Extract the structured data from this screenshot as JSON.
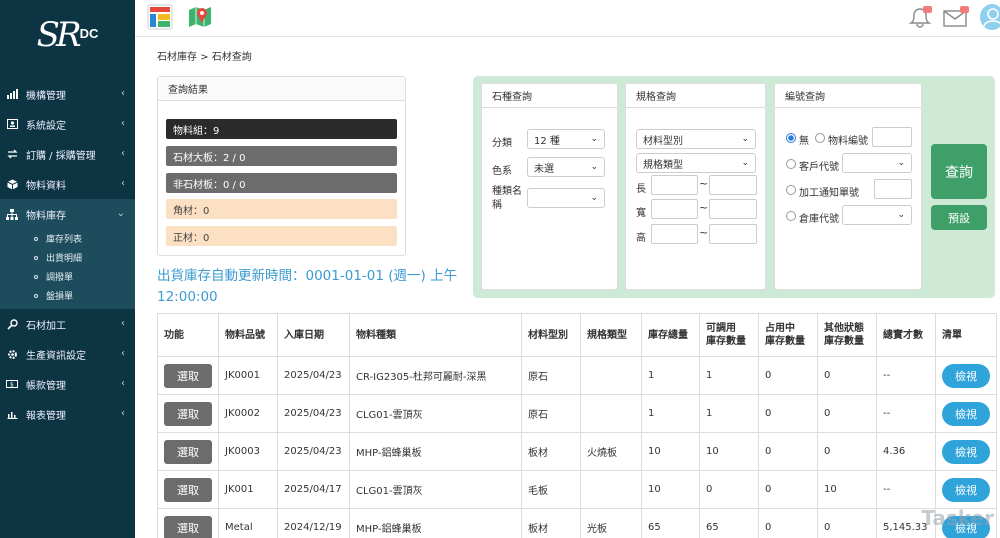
{
  "sidebar": {
    "logo": {
      "script": "SR",
      "suffix": "DC"
    },
    "items": [
      {
        "label": "機構管理",
        "icon": "bar-chart-icon"
      },
      {
        "label": "系統設定",
        "icon": "id-card-icon"
      },
      {
        "label": "訂購 / 採購管理",
        "icon": "exchange-icon"
      },
      {
        "label": "物料資料",
        "icon": "box-icon"
      },
      {
        "label": "物料庫存",
        "icon": "sitemap-icon"
      },
      {
        "label": "石材加工",
        "icon": "wrench-icon"
      },
      {
        "label": "生產資訊設定",
        "icon": "gear-icon"
      },
      {
        "label": "帳款管理",
        "icon": "money-icon"
      },
      {
        "label": "報表管理",
        "icon": "report-icon"
      }
    ],
    "sub_items": [
      "庫存列表",
      "出貨明細",
      "調撥單",
      "盤損單"
    ]
  },
  "breadcrumb": "石材庫存 > 石材查詢",
  "query_result": {
    "title": "查詢結果",
    "items": [
      "物料組：9",
      "石材大板：2 / 0",
      "非石材板：0 / 0",
      "角材：0",
      "正材：0"
    ]
  },
  "auto_update": "出貨庫存自動更新時間：0001-01-01 (週一) 上午12:00:00",
  "stone_query": {
    "title": "石種查詢",
    "category_label": "分類",
    "category_value": "12 種",
    "color_label": "色系",
    "color_value": "未選",
    "name_label": "種類名稱"
  },
  "spec_query": {
    "title": "規格查詢",
    "material_type": "材料型別",
    "spec_type": "規格類型",
    "length_label": "長",
    "width_label": "寬",
    "height_label": "高",
    "tilde": "~"
  },
  "number_query": {
    "title": "編號查詢",
    "none_label": "無",
    "material_no_label": "物料編號",
    "customer_label": "客戶代號",
    "process_label": "加工通知單號",
    "warehouse_label": "倉庫代號"
  },
  "buttons": {
    "query": "查詢",
    "default": "預設"
  },
  "table": {
    "headers": [
      "功能",
      "物料品號",
      "入庫日期",
      "物料種類",
      "材料型別",
      "規格類型",
      "庫存總量",
      "可調用\n庫存數量",
      "占用中\n庫存數量",
      "其他狀態\n庫存數量",
      "總實才數",
      "清單"
    ],
    "select_label": "選取",
    "view_label": "檢視",
    "rows": [
      [
        "JK0001",
        "2025/04/23",
        "CR-IG2305-杜邦可麗耐-深黑",
        "原石",
        "",
        "1",
        "1",
        "0",
        "0",
        "--"
      ],
      [
        "JK0002",
        "2025/04/23",
        "CLG01-雲頂灰",
        "原石",
        "",
        "1",
        "1",
        "0",
        "0",
        "--"
      ],
      [
        "JK0003",
        "2025/04/23",
        "MHP-鋁蜂巢板",
        "板材",
        "火燒板",
        "10",
        "10",
        "0",
        "0",
        "4.36"
      ],
      [
        "JK001",
        "2025/04/17",
        "CLG01-雲頂灰",
        "毛板",
        "",
        "10",
        "0",
        "0",
        "10",
        "--"
      ],
      [
        "Metal",
        "2024/12/19",
        "MHP-鋁蜂巢板",
        "板材",
        "光板",
        "65",
        "65",
        "0",
        "0",
        "5,145.33"
      ]
    ]
  },
  "watermark": "Tasker",
  "colors": {
    "sidebar": "#0c3442",
    "accent_green": "#3ea068",
    "view_blue": "#2fa4db",
    "link_blue": "#3a9ad2"
  }
}
